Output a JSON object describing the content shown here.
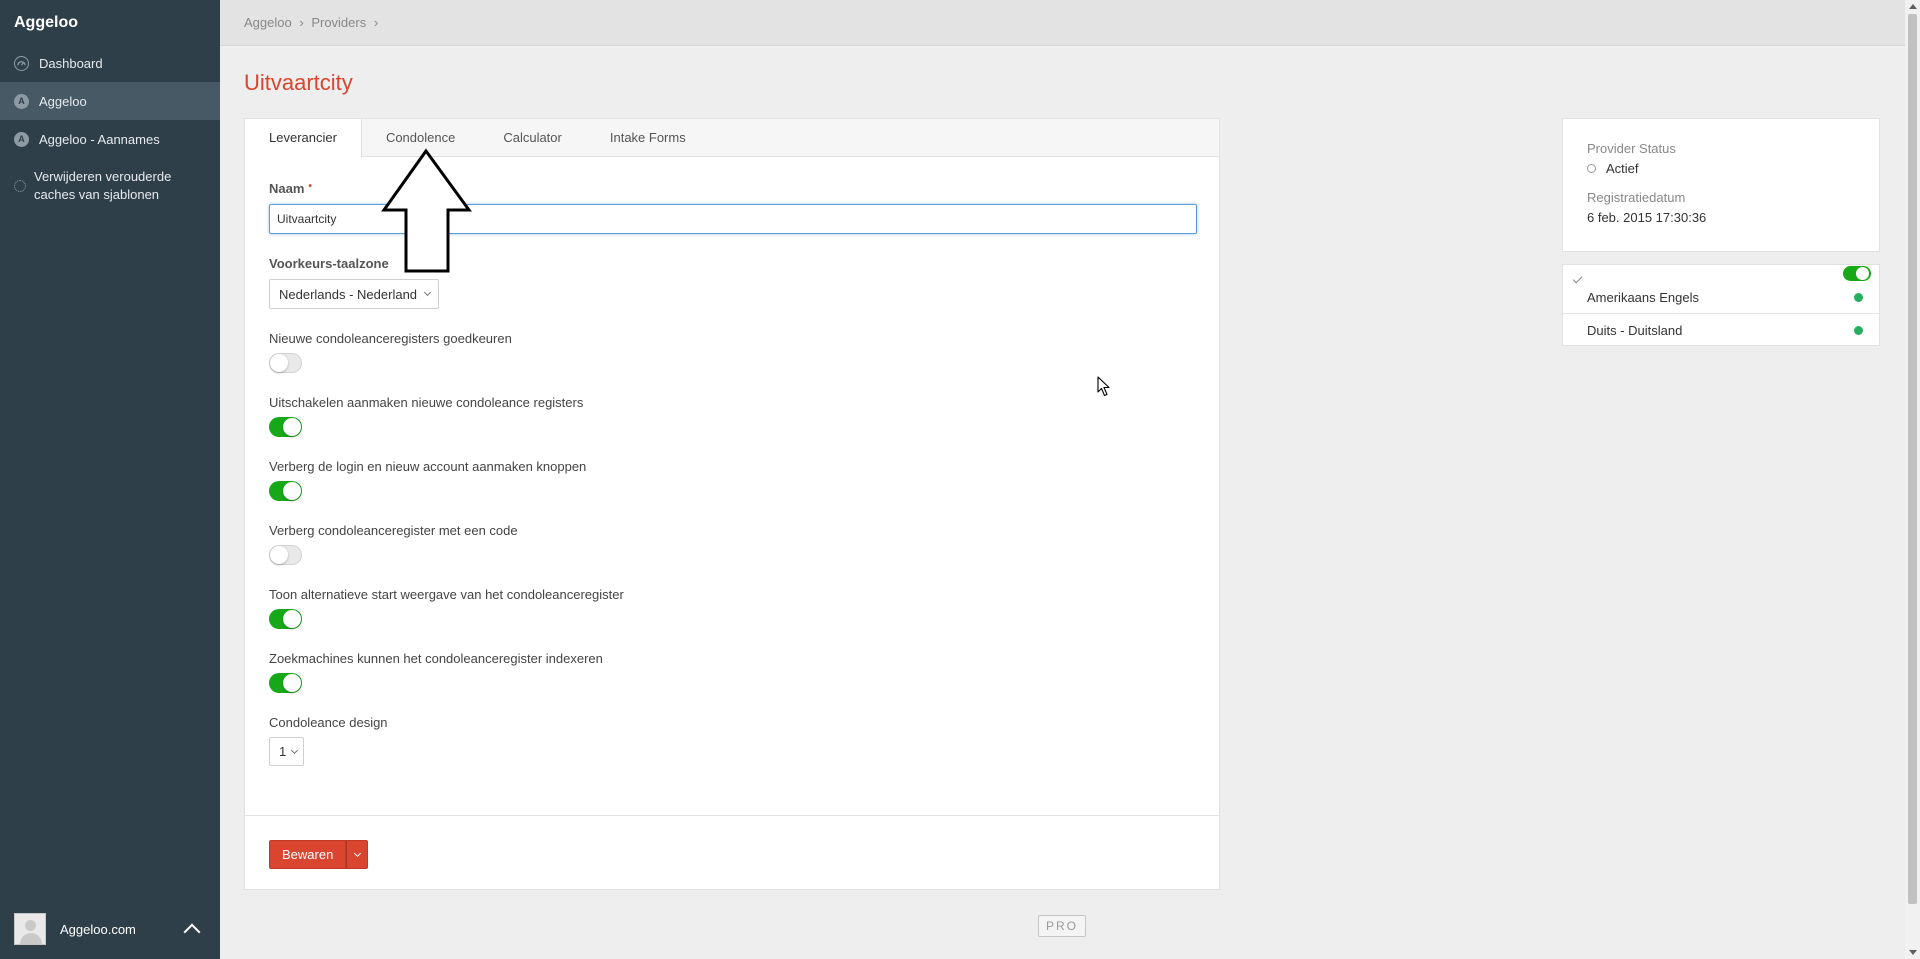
{
  "app": {
    "brand": "Aggeloo"
  },
  "sidebar": {
    "items": [
      {
        "icon": "dashboard-icon",
        "label": "Dashboard"
      },
      {
        "icon": "a-letter-icon",
        "icon_text": "A",
        "label": "Aggeloo"
      },
      {
        "icon": "a-letter-icon",
        "icon_text": "A",
        "label": "Aggeloo - Aannames"
      },
      {
        "icon": "spinner-icon",
        "label_line1": "Verwijderen verouderde",
        "label_line2": "caches van sjablonen"
      }
    ],
    "footer": {
      "name": "Aggeloo.com"
    }
  },
  "breadcrumb": {
    "part1": "Aggeloo",
    "sep": "›",
    "part2": "Providers"
  },
  "page": {
    "title": "Uitvaartcity"
  },
  "tabs": [
    "Leverancier",
    "Condolence",
    "Calculator",
    "Intake Forms"
  ],
  "form": {
    "naam_label": "Naam",
    "naam_required": "•",
    "naam_value": "Uitvaartcity",
    "locale_label": "Voorkeurs-taalzone",
    "locale_value": "Nederlands - Nederland",
    "toggles": [
      {
        "label": "Nieuwe condoleanceregisters goedkeuren",
        "on": false
      },
      {
        "label": "Uitschakelen aanmaken nieuwe condoleance registers",
        "on": true
      },
      {
        "label": "Verberg de login en nieuw account aanmaken knoppen",
        "on": true
      },
      {
        "label": "Verberg condoleanceregister met een code",
        "on": false
      },
      {
        "label": "Toon alternatieve start weergave van het condoleanceregister",
        "on": true
      },
      {
        "label": "Zoekmachines kunnen het condoleanceregister indexeren",
        "on": true
      }
    ],
    "design_label": "Condoleance design",
    "design_value": "1",
    "save_label": "Bewaren"
  },
  "status_panel": {
    "status_title": "Provider Status",
    "status_value": "Actief",
    "date_title": "Registratiedatum",
    "date_value": "6 feb. 2015 17:30:36"
  },
  "languages": [
    {
      "name": "Amerikaans Engels",
      "status_color": "#27ae60"
    },
    {
      "name": "Duits - Duitsland",
      "status_color": "#27ae60"
    }
  ],
  "footer_badge": "PRO",
  "colors": {
    "accent": "#d9452e",
    "sidebar": "#2f3f4a",
    "toggle_on": "#17a817"
  }
}
